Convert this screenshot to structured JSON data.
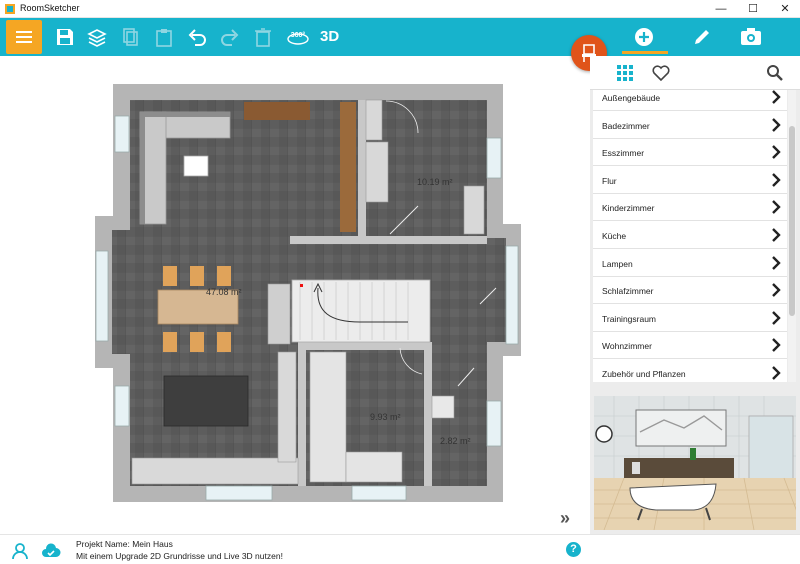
{
  "window": {
    "title": "RoomSketcher",
    "minimize_label": "—",
    "maximize_label": "☐",
    "close_label": "✕"
  },
  "toolbar": {
    "label_3d": "3D",
    "label_360": "360°",
    "icons": [
      "menu-icon",
      "save-icon",
      "layers-icon",
      "copy-icon",
      "paste-icon",
      "undo-icon",
      "redo-icon",
      "delete-icon",
      "view-360-icon"
    ]
  },
  "right_tabs": [
    "add-icon",
    "pencil-icon",
    "camera-icon"
  ],
  "panel": {
    "head_icons": [
      "grid-icon",
      "heart-icon",
      "search-icon"
    ],
    "categories": [
      "Außengebäude",
      "Badezimmer",
      "Esszimmer",
      "Flur",
      "Kinderzimmer",
      "Küche",
      "Lampen",
      "Schlafzimmer",
      "Trainingsraum",
      "Wohnzimmer",
      "Zubehör und Pflanzen"
    ]
  },
  "plan": {
    "areas": [
      "10.19 m²",
      "47.08 m²",
      "9.93 m²",
      "2.82 m²"
    ]
  },
  "status": {
    "project_line": "Projekt Name: Mein Haus",
    "upgrade_line": "Mit einem Upgrade 2D Grundrisse und Live 3D nutzen!",
    "help_label": "?"
  },
  "colors": {
    "toolbar": "#17b3cc",
    "accent": "#f5a623",
    "fab": "#e0541a",
    "floor": "#5f5f5f",
    "wall": "#b7b7b7"
  }
}
